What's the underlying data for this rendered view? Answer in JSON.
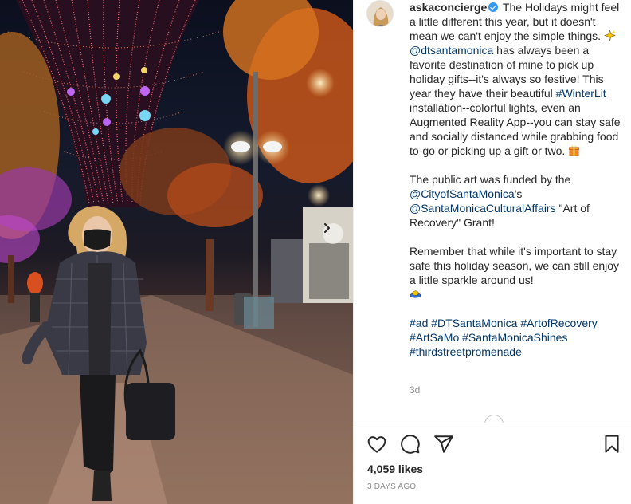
{
  "post": {
    "username": "askaconcierge",
    "caption_p1_a": " The Holidays might feel a little different this year, but it doesn't mean we can't enjoy the simple things. ",
    "mention_downtown": "@dtsantamonica",
    "caption_p1_b": " has always been a favorite destination of mine to pick up holiday gifts--it's always so festive! This year they have their beautiful ",
    "hashtag_winterlit": "#WinterLit",
    "caption_p1_c": " installation--colorful lights, even an Augmented Reality App--you can stay safe and socially distanced while grabbing food to-go or picking up a gift or two. ",
    "caption_p2_a": "The public art was funded by the ",
    "mention_city": "@CityofSantaMonica",
    "caption_p2_b": "'s ",
    "mention_cultural": "@SantaMonicaCulturalAffairs",
    "caption_p2_c": " \"Art of Recovery\" Grant!",
    "caption_p3": "Remember that while it's important to stay safe this holiday season, we can still enjoy a little sparkle around us!",
    "hashtags": [
      "#ad",
      "#DTSantaMonica",
      "#ArtofRecovery",
      "#ArtSaMo",
      "#SantaMonicaShines",
      "#thirdstreetpromenade"
    ],
    "time_ago": "3d",
    "likes": "4,059 likes",
    "date": "3 DAYS AGO"
  },
  "icons": {
    "like": "heart-icon",
    "comment": "comment-icon",
    "share": "paper-plane-icon",
    "save": "bookmark-icon",
    "next": "chevron-right-icon",
    "verified": "verified-badge-icon"
  },
  "colors": {
    "link": "#00376b",
    "verified": "#3897f0",
    "muted": "#8e8e8e",
    "text": "#262626"
  }
}
